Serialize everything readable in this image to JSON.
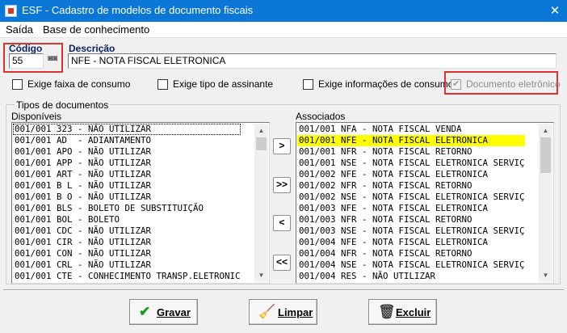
{
  "window": {
    "title": "ESF - Cadastro de modelos de documento fiscais",
    "close_glyph": "✕"
  },
  "menu": [
    "Saída",
    "Base de conhecimento"
  ],
  "form": {
    "codigo_label": "Código",
    "codigo_value": "55",
    "descricao_label": "Descrição",
    "descricao_value": "NFE - NOTA FISCAL ELETRONICA"
  },
  "options": [
    {
      "label": "Exige faixa de consumo",
      "checked": false,
      "enabled": true
    },
    {
      "label": "Exige tipo de assinante",
      "checked": false,
      "enabled": true
    },
    {
      "label": "Exige informações de consumo",
      "checked": false,
      "enabled": true
    },
    {
      "label": "Documento eletrônico",
      "checked": true,
      "enabled": false
    }
  ],
  "tipos": {
    "group_title": "Tipos de documentos",
    "disponiveis_label": "Disponíveis",
    "associados_label": "Associados",
    "disponiveis": [
      "001/001 323 - NÃO UTILIZAR",
      "001/001 AD  - ADIANTAMENTO",
      "001/001 APO - NÃO UTILIZAR",
      "001/001 APP - NÃO UTILIZAR",
      "001/001 ART - NÃO UTILIZAR",
      "001/001 B L - NÃO UTILIZAR",
      "001/001 B O - NÃO UTILIZAR",
      "001/001 BLS - BOLETO DE SUBSTITUIÇÃO",
      "001/001 BOL - BOLETO",
      "001/001 CDC - NÃO UTILIZAR",
      "001/001 CIR - NÃO UTILIZAR",
      "001/001 CON - NÃO UTILIZAR",
      "001/001 CRL - NÃO UTILIZAR",
      "001/001 CTE - CONHECIMENTO TRANSP.ELETRONIC"
    ],
    "associados": [
      "001/001 NFA - NOTA FISCAL VENDA",
      "001/001 NFE - NOTA FISCAL ELETRONICA",
      "001/001 NFR - NOTA FISCAL RETORNO",
      "001/001 NSE - NOTA FISCAL ELETRONICA SERVIÇ",
      "001/002 NFE - NOTA FISCAL ELETRONICA",
      "001/002 NFR - NOTA FISCAL RETORNO",
      "001/002 NSE - NOTA FISCAL ELETRONICA SERVIÇ",
      "001/003 NFE - NOTA FISCAL ELETRONICA",
      "001/003 NFR - NOTA FISCAL RETORNO",
      "001/003 NSE - NOTA FISCAL ELETRONICA SERVIÇ",
      "001/004 NFE - NOTA FISCAL ELETRONICA",
      "001/004 NFR - NOTA FISCAL RETORNO",
      "001/004 NSE - NOTA FISCAL ELETRONICA SERVIÇ",
      "001/004 RES - NÃO UTILIZAR"
    ],
    "highlight_color": "#ffff00"
  },
  "move_buttons": [
    ">",
    ">>",
    "<",
    "<<"
  ],
  "actions": {
    "gravar": "Gravar",
    "limpar": "Limpar",
    "excluir": "Excluir"
  },
  "colors": {
    "titlebar": "#0a77d6",
    "annotation_box": "#e0322e",
    "label_blue": "#0a246a"
  }
}
